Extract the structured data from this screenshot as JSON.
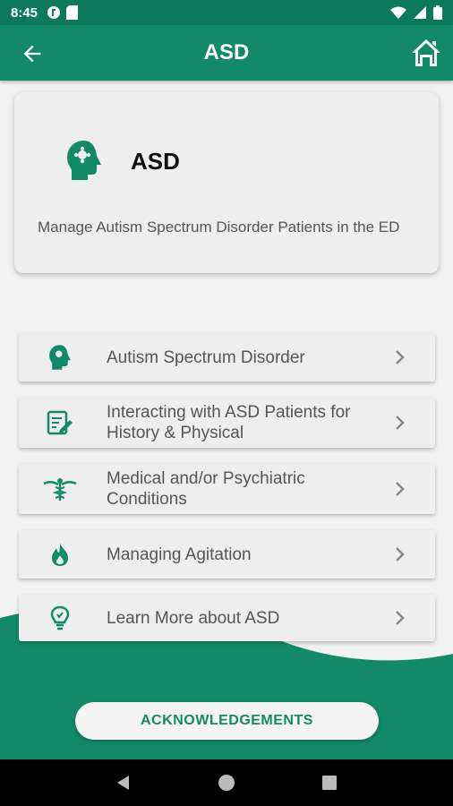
{
  "status_bar": {
    "time": "8:45"
  },
  "app_bar": {
    "title": "ASD"
  },
  "header_card": {
    "title": "ASD",
    "description": "Manage Autism Spectrum Disorder Patients in the ED"
  },
  "menu": [
    {
      "label": "Autism Spectrum Disorder",
      "icon": "head-puzzle-icon"
    },
    {
      "label": "Interacting with ASD Patients for History & Physical",
      "icon": "clipboard-edit-icon"
    },
    {
      "label": "Medical and/or Psychiatric Conditions",
      "icon": "caduceus-icon"
    },
    {
      "label": "Managing Agitation",
      "icon": "flame-icon"
    },
    {
      "label": "Learn More about ASD",
      "icon": "lightbulb-icon"
    }
  ],
  "acknowledgements": {
    "label": "ACKNOWLEDGEMENTS"
  },
  "colors": {
    "primary": "#138a67",
    "status_bar": "#0c7a5a",
    "card": "#eeeeee",
    "background": "#f2f2f2"
  }
}
